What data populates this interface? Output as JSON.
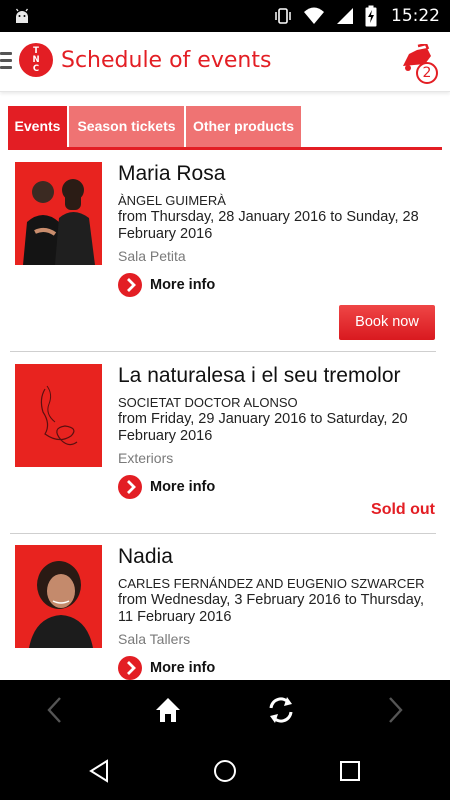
{
  "status_bar": {
    "time": "15:22"
  },
  "app_bar": {
    "logo_letters": [
      "T",
      "N",
      "C"
    ],
    "title": "Schedule of events",
    "cart_count": "2"
  },
  "tabs": [
    {
      "label": "Events",
      "active": true
    },
    {
      "label": "Season tickets",
      "active": false
    },
    {
      "label": "Other products",
      "active": false
    }
  ],
  "events": [
    {
      "title": "Maria Rosa",
      "author": "ÀNGEL GUIMERÀ",
      "dates": "from Thursday, 28 January 2016 to Sunday, 28 February 2016",
      "venue": "Sala Petita",
      "more_info": "More info",
      "action": "Book now"
    },
    {
      "title": "La naturalesa i el seu tremolor",
      "author": "SOCIETAT DOCTOR ALONSO",
      "dates": "from Friday, 29 January 2016 to Saturday, 20 February 2016",
      "venue": "Exteriors",
      "more_info": "More info",
      "action": "Sold out"
    },
    {
      "title": "Nadia",
      "author": "CARLES FERNÁNDEZ AND EUGENIO SZWARCER",
      "dates": "from Wednesday, 3 February 2016 to Thursday, 11 February 2016",
      "venue": "Sala Tallers",
      "more_info": "More info"
    }
  ],
  "toolbar": {
    "icons": [
      "back-arrow-icon",
      "home-icon",
      "refresh-icon",
      "forward-arrow-icon"
    ]
  },
  "colors": {
    "brand": "#e31e24",
    "tab_inactive": "#ef7373",
    "venue_gray": "#7a7a7a"
  }
}
